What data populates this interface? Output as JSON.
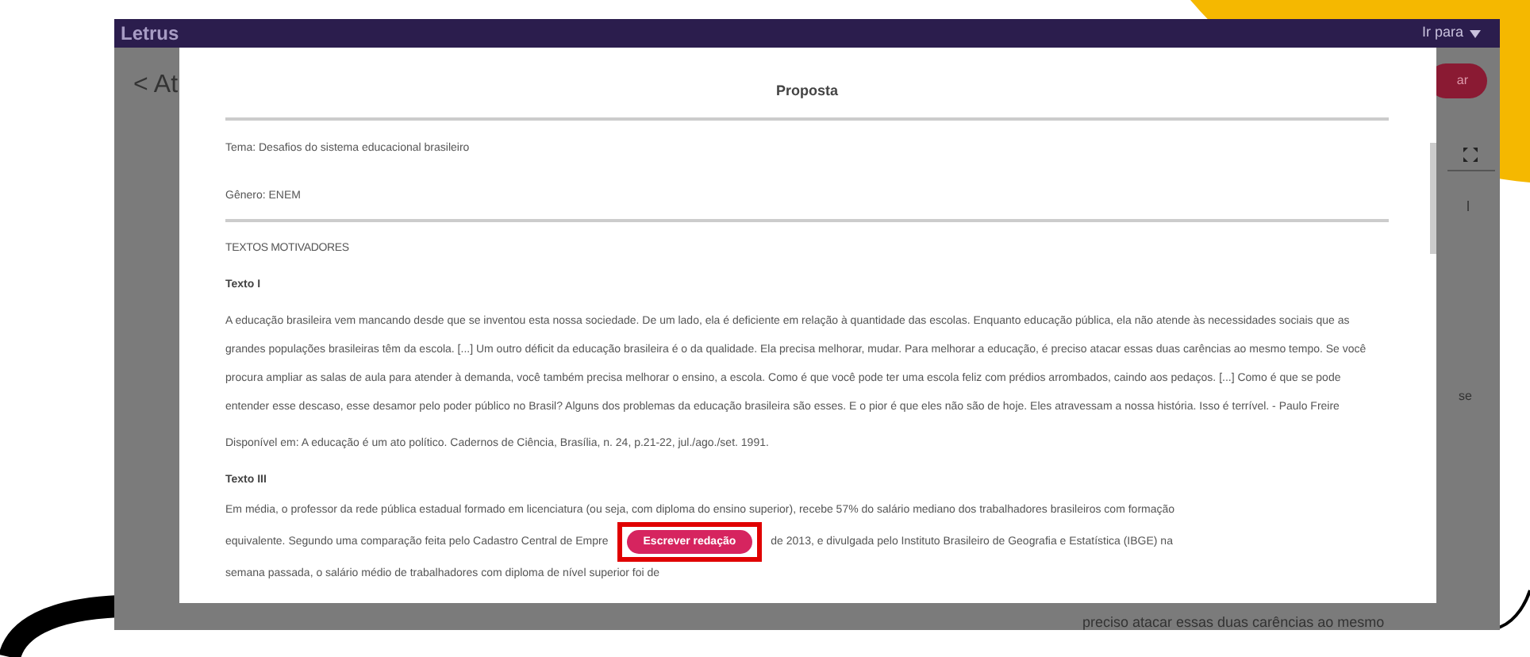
{
  "app": {
    "logo": "Letrus",
    "nav_menu": "Ir para",
    "back_title": "< At",
    "action_button": "ar",
    "side_fragment_1": "l",
    "side_fragment_2": "se",
    "footer_fragment": "preciso atacar essas duas carências ao mesmo"
  },
  "modal": {
    "title": "Proposta",
    "tema": "Tema: Desafios do sistema educacional brasileiro",
    "genero": "Gênero: ENEM",
    "section_heading": "TEXTOS MOTIVADORES",
    "texts": [
      {
        "heading": "Texto I",
        "kind": "plain",
        "paragraph": "A educação brasileira vem mancando desde que se inventou esta nossa sociedade. De um lado, ela é deficiente em relação à quantidade das escolas. Enquanto educação pública, ela não atende às necessidades sociais que as grandes populações brasileiras têm da escola. [...] Um outro déficit da educação brasileira é o da qualidade. Ela precisa melhorar, mudar. Para melhorar a educação, é preciso atacar essas duas carências ao mesmo tempo. Se você procura ampliar as salas de aula para atender à demanda, você também precisa melhorar o ensino, a escola. Como é que você pode ter uma escola feliz com prédios arrombados, caindo aos pedaços. [...] Como é que se pode entender esse descaso, esse desamor pelo poder público no Brasil? Alguns dos problemas da educação brasileira são esses. E o pior é que eles não são de hoje. Eles atravessam a nossa história. Isso é terrível. - Paulo Freire",
        "source": "Disponível em: A educação é um ato político. Cadernos de Ciência, Brasília, n. 24, p.21-22, jul./ago./set. 1991."
      },
      {
        "heading": "Texto III",
        "kind": "covered",
        "line_1": "Em média, o professor da rede pública estadual formado em licenciatura (ou seja, com diploma do ensino superior), recebe 57% do salário mediano dos trabalhadores brasileiros com formação",
        "line_2_before": "equivalente. Segundo uma comparação feita pelo Cadastro Central de Empre",
        "line_2_after": "de 2013, e divulgada pelo Instituto Brasileiro de Geografia e Estatística (IBGE) na",
        "line_3": "semana passada, o salário médio de trabalhadores com diploma de nível superior foi de"
      }
    ],
    "write_button": "Escrever redação"
  }
}
